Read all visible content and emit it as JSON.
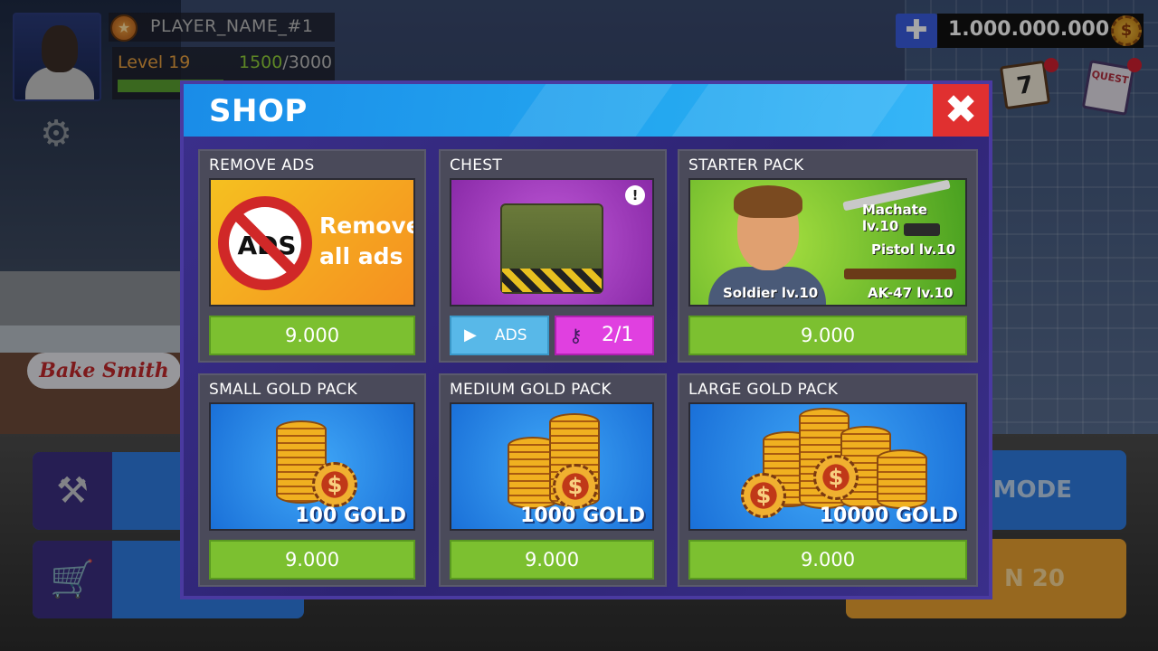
{
  "hud": {
    "player_name": "PLAYER_NAME_#1",
    "level": "Level 19",
    "xp_current": "1500",
    "xp_total": "/3000",
    "xp_fraction": 0.5,
    "currency_amount": "1.000.000.000",
    "currency_icon": "$",
    "calendar_day": "7",
    "quest_label": "QUEST",
    "mode_button_label": "MODE",
    "start_button_label": "N 20"
  },
  "background": {
    "store_sign": "Bake Smith"
  },
  "shop": {
    "title": "SHOP",
    "close_icon": "✖",
    "cards": {
      "remove_ads": {
        "title": "REMOVE ADS",
        "sign_text": "ADS",
        "caption_line1": "Remove",
        "caption_line2": "all ads",
        "price": "9.000"
      },
      "chest": {
        "title": "CHEST",
        "alert": "!",
        "ads_label": "ADS",
        "key_count": "2/1"
      },
      "starter_pack": {
        "title": "STARTER PACK",
        "items": {
          "machete": "Machate lv.10",
          "pistol": "Pistol lv.10",
          "ak47": "AK-47 lv.10",
          "soldier": "Soldier lv.10"
        },
        "price": "9.000"
      },
      "small_gold": {
        "title": "SMALL GOLD PACK",
        "amount": "100 GOLD",
        "price": "9.000"
      },
      "medium_gold": {
        "title": "MEDIUM GOLD PACK",
        "amount": "1000 GOLD",
        "price": "9.000"
      },
      "large_gold": {
        "title": "LARGE GOLD PACK",
        "amount": "10000 GOLD",
        "price": "9.000"
      }
    }
  },
  "colors": {
    "header_blue": "#24a8f0",
    "close_red": "#e03030",
    "price_green": "#7cc030",
    "panel_purple": "#3c2c8c",
    "key_magenta": "#e040e0",
    "ads_blue": "#58b8e8"
  }
}
